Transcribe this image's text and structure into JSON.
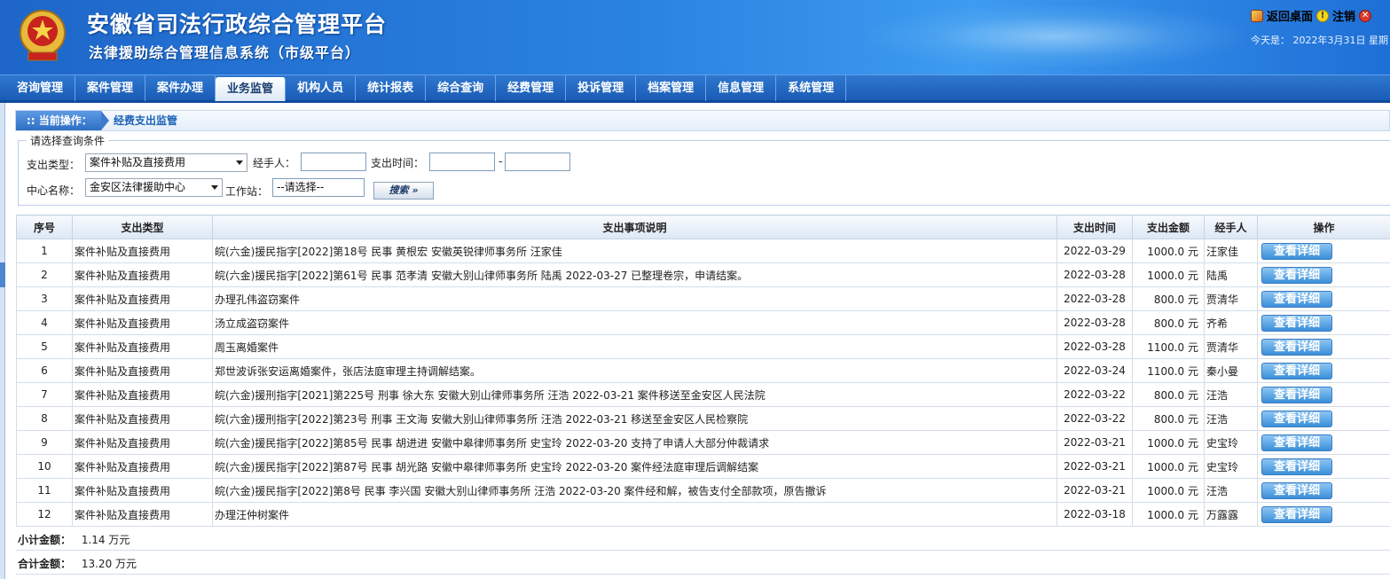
{
  "header": {
    "title": "安徽省司法行政综合管理平台",
    "subtitle": "法律援助综合管理信息系统（市级平台）",
    "return_desktop": "返回桌面",
    "logout": "注销",
    "today": "今天是： 2022年3月31日  星期"
  },
  "nav": {
    "items": [
      "咨询管理",
      "案件管理",
      "案件办理",
      "业务监管",
      "机构人员",
      "统计报表",
      "综合查询",
      "经费管理",
      "投诉管理",
      "档案管理",
      "信息管理",
      "系统管理"
    ],
    "active": "业务监管"
  },
  "breadcrumb": {
    "label": ":: 当前操作：",
    "value": "经费支出监管"
  },
  "filter": {
    "legend": "请选择查询条件",
    "type_label": "支出类型：",
    "type_value": "案件补贴及直接费用",
    "handler_label": "经手人：",
    "time_label": "支出时间：",
    "dash": "-",
    "center_label": "中心名称：",
    "center_value": "金安区法律援助中心",
    "station_label": "工作站：",
    "station_value": "--请选择--",
    "search_button": "搜索 »"
  },
  "table": {
    "headers": [
      "序号",
      "支出类型",
      "支出事项说明",
      "支出时间",
      "支出金额",
      "经手人",
      "操作"
    ],
    "detail_label": "查看详细",
    "rows": [
      {
        "no": "1",
        "type": "案件补贴及直接费用",
        "desc": "皖(六金)援民指字[2022]第18号  民事  黄根宏  安徽英锐律师事务所  汪家佳",
        "date": "2022-03-29",
        "amount": "1000.0  元",
        "handler": "汪家佳"
      },
      {
        "no": "2",
        "type": "案件补贴及直接费用",
        "desc": "皖(六金)援民指字[2022]第61号  民事  范孝清  安徽大别山律师事务所  陆禹  2022-03-27 已整理卷宗，申请结案。",
        "date": "2022-03-28",
        "amount": "1000.0  元",
        "handler": "陆禹"
      },
      {
        "no": "3",
        "type": "案件补贴及直接费用",
        "desc": "办理孔伟盗窃案件",
        "date": "2022-03-28",
        "amount": "800.0  元",
        "handler": "贾清华"
      },
      {
        "no": "4",
        "type": "案件补贴及直接费用",
        "desc": "汤立成盗窃案件",
        "date": "2022-03-28",
        "amount": "800.0  元",
        "handler": "齐希"
      },
      {
        "no": "5",
        "type": "案件补贴及直接费用",
        "desc": "周玉离婚案件",
        "date": "2022-03-28",
        "amount": "1100.0  元",
        "handler": "贾清华"
      },
      {
        "no": "6",
        "type": "案件补贴及直接费用",
        "desc": "郑世波诉张安运离婚案件，张店法庭审理主持调解结案。",
        "date": "2022-03-24",
        "amount": "1100.0  元",
        "handler": "秦小曼"
      },
      {
        "no": "7",
        "type": "案件补贴及直接费用",
        "desc": "皖(六金)援刑指字[2021]第225号  刑事  徐大东  安徽大别山律师事务所  汪浩  2022-03-21 案件移送至金安区人民法院",
        "date": "2022-03-22",
        "amount": "800.0  元",
        "handler": "汪浩"
      },
      {
        "no": "8",
        "type": "案件补贴及直接费用",
        "desc": "皖(六金)援刑指字[2022]第23号  刑事  王文海  安徽大别山律师事务所  汪浩  2022-03-21 移送至金安区人民检察院",
        "date": "2022-03-22",
        "amount": "800.0  元",
        "handler": "汪浩"
      },
      {
        "no": "9",
        "type": "案件补贴及直接费用",
        "desc": "皖(六金)援民指字[2022]第85号  民事  胡进进  安徽中皋律师事务所  史宝玲  2022-03-20 支持了申请人大部分仲裁请求",
        "date": "2022-03-21",
        "amount": "1000.0  元",
        "handler": "史宝玲"
      },
      {
        "no": "10",
        "type": "案件补贴及直接费用",
        "desc": "皖(六金)援民指字[2022]第87号  民事  胡光路  安徽中皋律师事务所  史宝玲  2022-03-20 案件经法庭审理后调解结案",
        "date": "2022-03-21",
        "amount": "1000.0  元",
        "handler": "史宝玲"
      },
      {
        "no": "11",
        "type": "案件补贴及直接费用",
        "desc": "皖(六金)援民指字[2022]第8号  民事  李兴国  安徽大别山律师事务所  汪浩  2022-03-20 案件经和解，被告支付全部款项，原告撤诉",
        "date": "2022-03-21",
        "amount": "1000.0  元",
        "handler": "汪浩"
      },
      {
        "no": "12",
        "type": "案件补贴及直接费用",
        "desc": "办理汪仲树案件",
        "date": "2022-03-18",
        "amount": "1000.0  元",
        "handler": "万露露"
      }
    ]
  },
  "summary": {
    "subtotal_label": "小计金额：",
    "subtotal_value": "1.14  万元",
    "total_label": "合计金额：",
    "total_value": "13.20  万元"
  }
}
